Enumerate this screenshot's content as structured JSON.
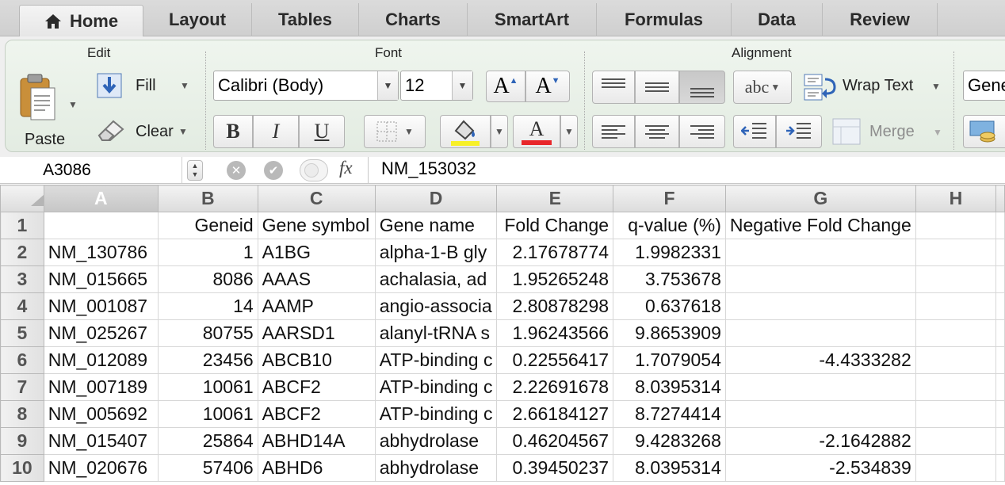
{
  "tabs": [
    "Home",
    "Layout",
    "Tables",
    "Charts",
    "SmartArt",
    "Formulas",
    "Data",
    "Review"
  ],
  "ribbon": {
    "edit": {
      "title": "Edit",
      "paste": "Paste",
      "fill": "Fill",
      "clear": "Clear"
    },
    "font": {
      "title": "Font",
      "font_name": "Calibri (Body)",
      "font_size": "12",
      "grow_label": "A",
      "shrink_label": "A",
      "bold": "B",
      "italic": "I",
      "underline": "U",
      "font_color_label": "A",
      "highlight_color": "#f7f028",
      "font_color": "#e8262a"
    },
    "alignment": {
      "title": "Alignment",
      "orientation_label": "abc",
      "wrap_text": "Wrap Text",
      "merge": "Merge"
    },
    "number": {
      "format": "Gene"
    }
  },
  "formula_bar": {
    "name_box": "A3086",
    "fx": "fx",
    "formula": "NM_153032"
  },
  "sheet": {
    "columns": [
      "A",
      "B",
      "C",
      "D",
      "E",
      "F",
      "G",
      "H"
    ],
    "header_row": [
      "",
      "Geneid",
      "Gene symbol",
      "Gene name",
      "Fold Change",
      "q-value (%)",
      "Negative Fold Change",
      ""
    ],
    "rows": [
      {
        "num": "2",
        "cells": [
          "NM_130786",
          "1",
          "A1BG",
          "alpha-1-B gly",
          "2.17678774",
          "1.9982331",
          "",
          ""
        ]
      },
      {
        "num": "3",
        "cells": [
          "NM_015665",
          "8086",
          "AAAS",
          "achalasia, ad",
          "1.95265248",
          "3.753678",
          "",
          ""
        ]
      },
      {
        "num": "4",
        "cells": [
          "NM_001087",
          "14",
          "AAMP",
          "angio-associa",
          "2.80878298",
          "0.637618",
          "",
          ""
        ]
      },
      {
        "num": "5",
        "cells": [
          "NM_025267",
          "80755",
          "AARSD1",
          "alanyl-tRNA s",
          "1.96243566",
          "9.8653909",
          "",
          ""
        ]
      },
      {
        "num": "6",
        "cells": [
          "NM_012089",
          "23456",
          "ABCB10",
          "ATP-binding c",
          "0.22556417",
          "1.7079054",
          "-4.4333282",
          ""
        ]
      },
      {
        "num": "7",
        "cells": [
          "NM_007189",
          "10061",
          "ABCF2",
          "ATP-binding c",
          "2.22691678",
          "8.0395314",
          "",
          ""
        ]
      },
      {
        "num": "8",
        "cells": [
          "NM_005692",
          "10061",
          "ABCF2",
          "ATP-binding c",
          "2.66184127",
          "8.7274414",
          "",
          ""
        ]
      },
      {
        "num": "9",
        "cells": [
          "NM_015407",
          "25864",
          "ABHD14A",
          "abhydrolase",
          "0.46204567",
          "9.4283268",
          "-2.1642882",
          ""
        ]
      },
      {
        "num": "10",
        "cells": [
          "NM_020676",
          "57406",
          "ABHD6",
          "abhydrolase",
          "0.39450237",
          "8.0395314",
          "-2.534839",
          ""
        ]
      }
    ]
  }
}
